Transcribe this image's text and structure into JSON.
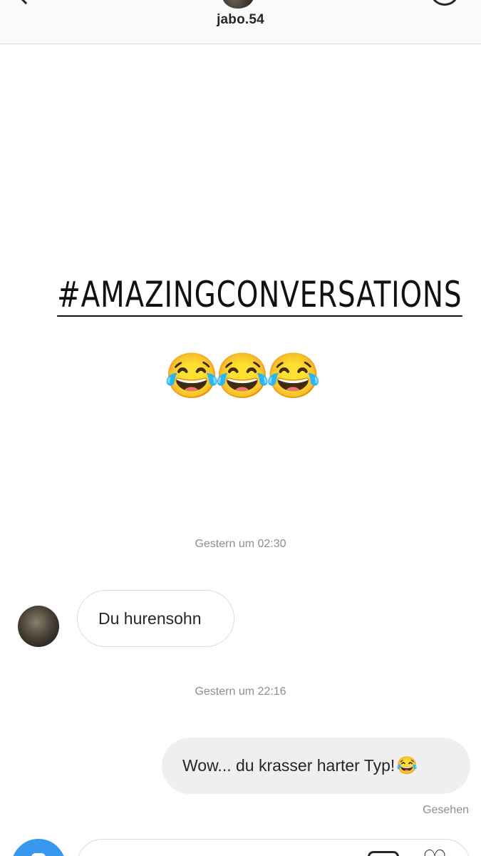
{
  "header": {
    "username": "jabo.54"
  },
  "story": {
    "hashtag": "#AMAZINGCONVERSATIONS",
    "emoji": "😂😂😂"
  },
  "messages": [
    {
      "timestamp": "Gestern um 02:30",
      "direction": "incoming",
      "text": "Du hurensohn"
    },
    {
      "timestamp": "Gestern um 22:16",
      "direction": "outgoing",
      "text": "Wow... du krasser harter Typ!",
      "emoji": "😂"
    }
  ],
  "status": {
    "seen": "Gesehen"
  },
  "colors": {
    "accent": "#3897f0",
    "outgoing_bubble": "#efefef",
    "muted_text": "#8e8e8e"
  },
  "icons": {
    "back": "chevron-left-icon",
    "info": "info-icon",
    "camera": "camera-icon",
    "gallery": "gallery-icon",
    "like": "heart-icon"
  }
}
